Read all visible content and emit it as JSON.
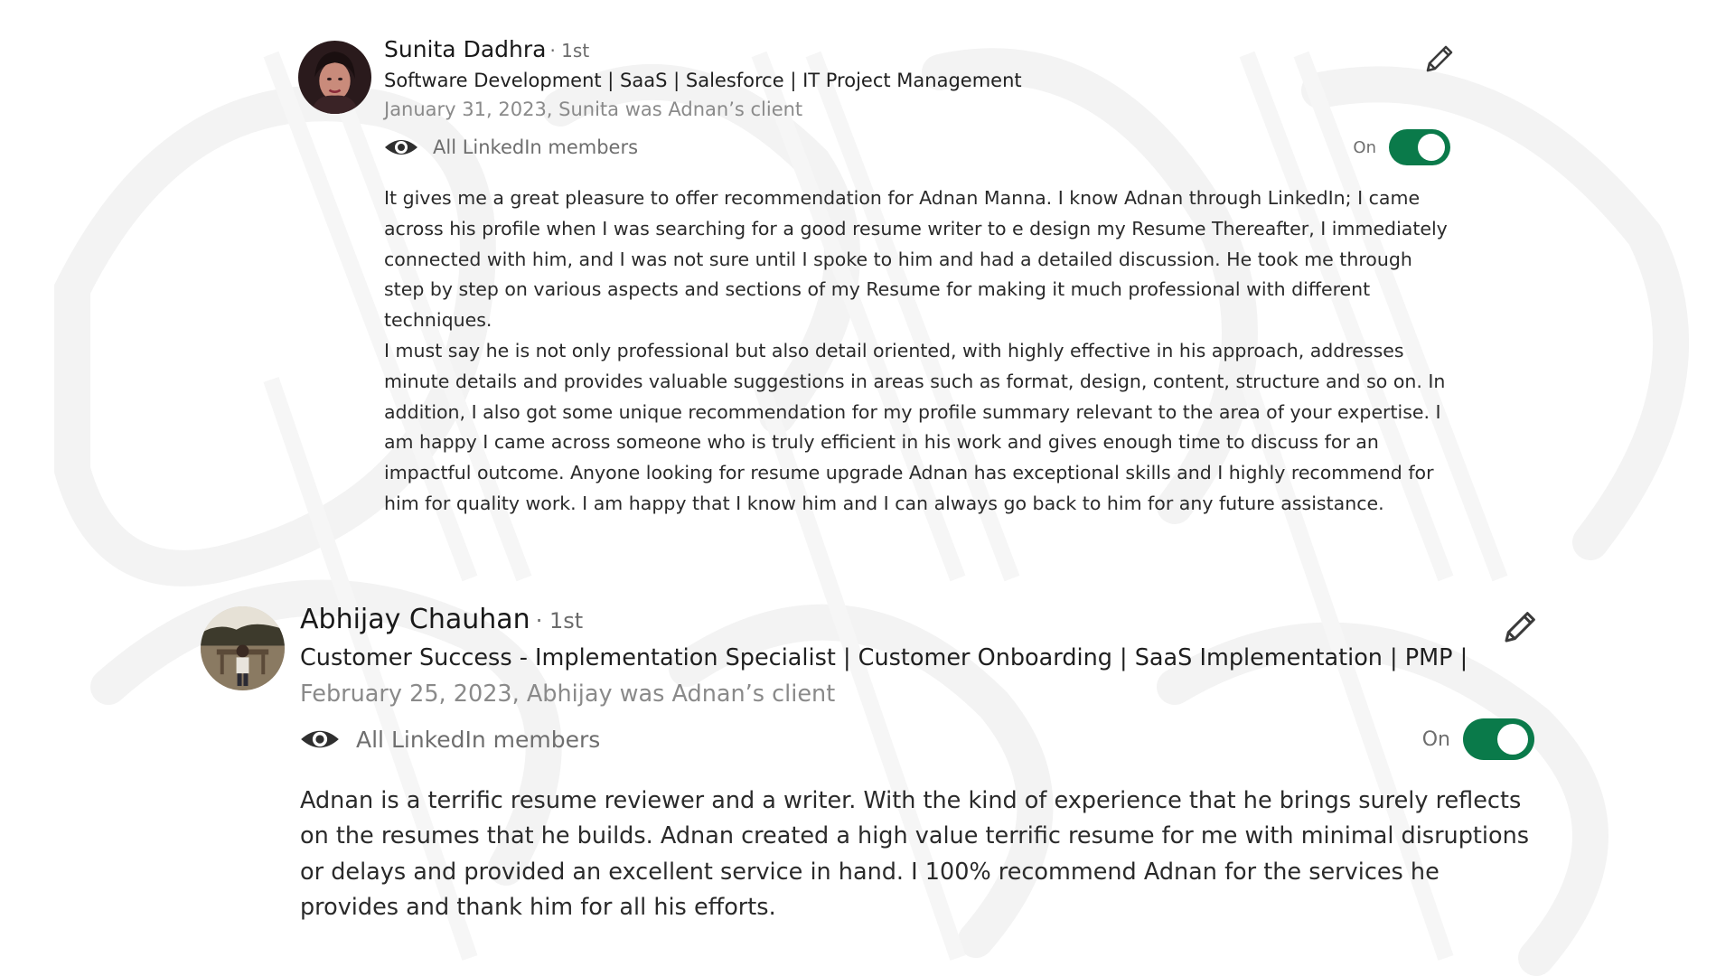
{
  "colors": {
    "toggle_on": "#0a7a4a",
    "secondary_text": "#6e6e6e",
    "date_text": "#8a8a8a",
    "primary_text": "#191919"
  },
  "recommendations": [
    {
      "name": "Sunita Dadhra",
      "degree": "· 1st",
      "headline": "Software Development | SaaS | Salesforce | IT Project Management",
      "date_relation": "January 31, 2023, Sunita was Adnan’s client",
      "visibility": "All LinkedIn members",
      "visibility_icon": "eye-icon",
      "toggle_label": "On",
      "toggle_on": true,
      "edit_icon": "pencil-icon",
      "paragraphs": [
        "It gives me a great pleasure to offer recommendation for Adnan Manna. I know Adnan through LinkedIn; I came across his profile when I was searching for a good resume writer to e design my Resume Thereafter, I immediately connected with him, and I was not sure until I spoke to him and had a detailed discussion. He took me through step by step on various aspects and sections of my Resume for making it much professional with different techniques.",
        "I must say he is not only professional but also detail oriented, with highly effective in his approach, addresses minute details and provides valuable suggestions in areas such as format, design, content, structure and so on. In addition, I also got some unique recommendation for my profile summary relevant to the area of your expertise. I am happy I came across someone who is truly efficient in his work and gives enough time to discuss for an impactful outcome. Anyone looking for resume upgrade Adnan has exceptional skills and I highly recommend for him for quality work. I am happy that I know him and I can always go back to him for any future assistance."
      ]
    },
    {
      "name": "Abhijay Chauhan",
      "degree": "· 1st",
      "headline": "Customer Success - Implementation Specialist | Customer Onboarding | SaaS Implementation | PMP |",
      "date_relation": "February 25, 2023, Abhijay was Adnan’s client",
      "visibility": "All LinkedIn members",
      "visibility_icon": "eye-icon",
      "toggle_label": "On",
      "toggle_on": true,
      "edit_icon": "pencil-icon",
      "paragraphs": [
        "Adnan is a terrific resume reviewer and a writer. With the kind of experience that he brings surely reflects on the resumes that he builds. Adnan created a high value terrific resume for me with minimal disruptions or delays and provided an excellent service in hand. I 100% recommend Adnan for the services he provides and thank him for all his efforts."
      ]
    }
  ]
}
